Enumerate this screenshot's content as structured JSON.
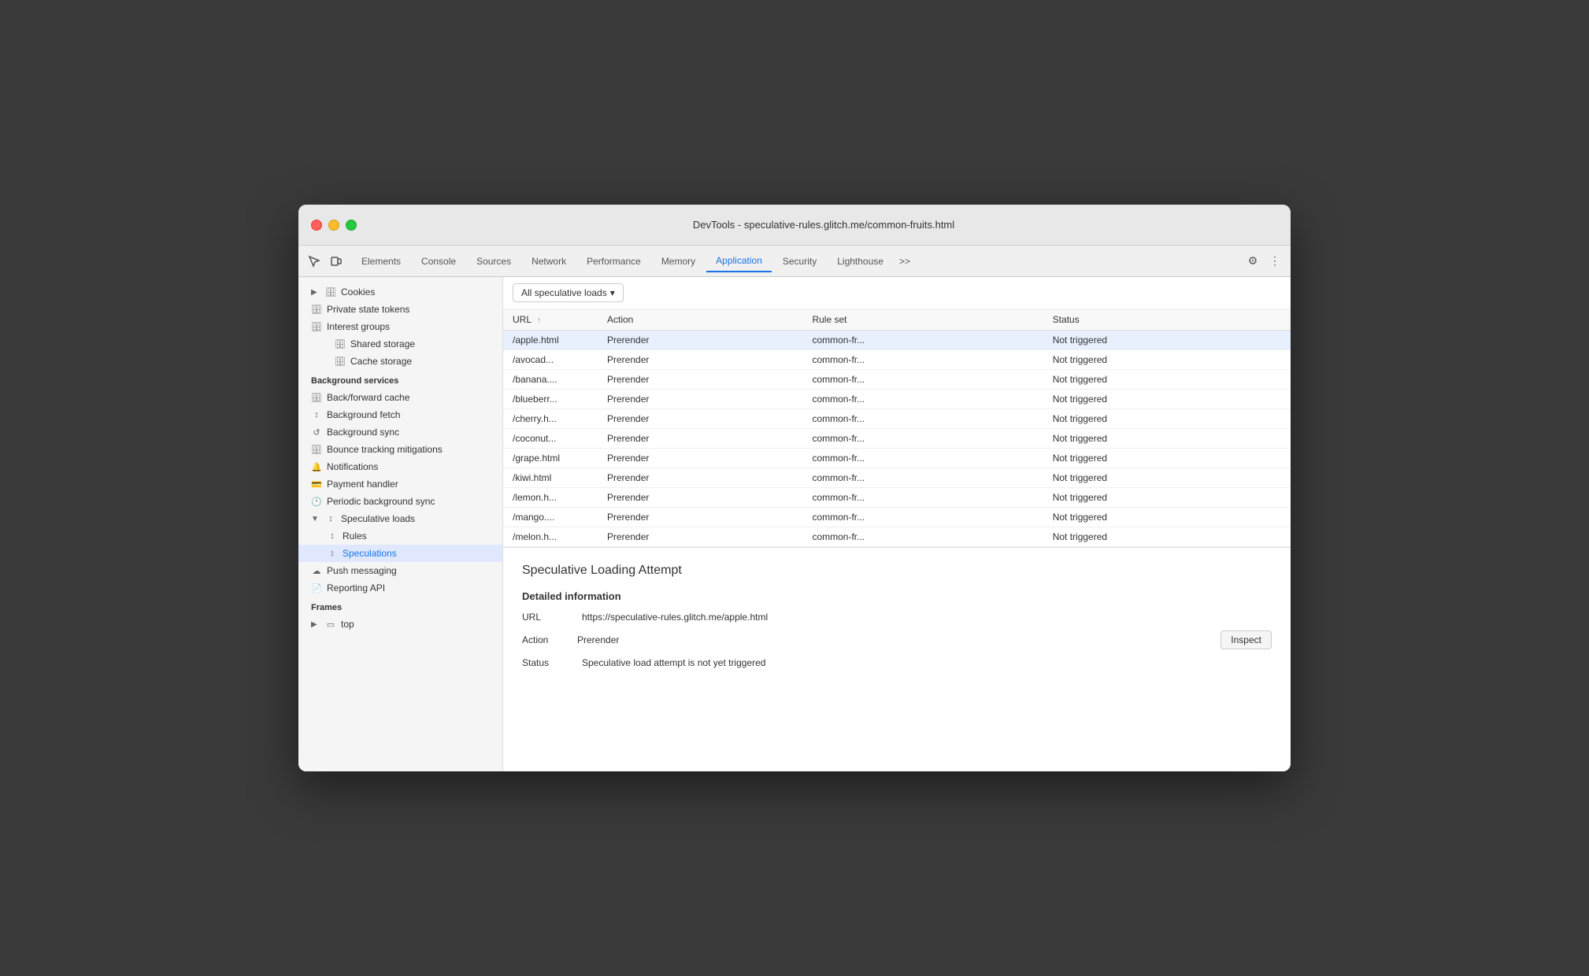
{
  "window": {
    "title": "DevTools - speculative-rules.glitch.me/common-fruits.html"
  },
  "tabs": {
    "items": [
      {
        "label": "Elements",
        "active": false
      },
      {
        "label": "Console",
        "active": false
      },
      {
        "label": "Sources",
        "active": false
      },
      {
        "label": "Network",
        "active": false
      },
      {
        "label": "Performance",
        "active": false
      },
      {
        "label": "Memory",
        "active": false
      },
      {
        "label": "Application",
        "active": true
      },
      {
        "label": "Security",
        "active": false
      },
      {
        "label": "Lighthouse",
        "active": false
      }
    ],
    "more_label": ">>"
  },
  "sidebar": {
    "sections": [
      {
        "name": "storage-section",
        "items": [
          {
            "id": "cookies",
            "label": "Cookies",
            "icon": "db",
            "indent": 1,
            "arrow": true,
            "collapsed": true
          },
          {
            "id": "private-state-tokens",
            "label": "Private state tokens",
            "icon": "db",
            "indent": 0
          },
          {
            "id": "interest-groups",
            "label": "Interest groups",
            "icon": "db",
            "indent": 0
          },
          {
            "id": "shared-storage",
            "label": "Shared storage",
            "icon": "db",
            "indent": 1,
            "arrow": false,
            "collapsed": false
          },
          {
            "id": "cache-storage",
            "label": "Cache storage",
            "icon": "db",
            "indent": 1,
            "arrow": false,
            "collapsed": false
          }
        ]
      },
      {
        "name": "background-services",
        "label": "Background services",
        "items": [
          {
            "id": "back-forward-cache",
            "label": "Back/forward cache",
            "icon": "db",
            "indent": 0
          },
          {
            "id": "background-fetch",
            "label": "Background fetch",
            "icon": "sync",
            "indent": 0
          },
          {
            "id": "background-sync",
            "label": "Background sync",
            "icon": "sync",
            "indent": 0
          },
          {
            "id": "bounce-tracking",
            "label": "Bounce tracking mitigations",
            "icon": "db",
            "indent": 0
          },
          {
            "id": "notifications",
            "label": "Notifications",
            "icon": "bell",
            "indent": 0
          },
          {
            "id": "payment-handler",
            "label": "Payment handler",
            "icon": "card",
            "indent": 0
          },
          {
            "id": "periodic-background-sync",
            "label": "Periodic background sync",
            "icon": "clock",
            "indent": 0
          },
          {
            "id": "speculative-loads",
            "label": "Speculative loads",
            "icon": "sync",
            "indent": 0,
            "arrow": true,
            "expanded": true
          },
          {
            "id": "rules",
            "label": "Rules",
            "icon": "sync",
            "indent": 1
          },
          {
            "id": "speculations",
            "label": "Speculations",
            "icon": "sync",
            "indent": 1,
            "active": true
          },
          {
            "id": "push-messaging",
            "label": "Push messaging",
            "icon": "cloud",
            "indent": 0
          },
          {
            "id": "reporting-api",
            "label": "Reporting API",
            "icon": "file",
            "indent": 0
          }
        ]
      },
      {
        "name": "frames-section",
        "label": "Frames",
        "items": [
          {
            "id": "top-frame",
            "label": "top",
            "icon": "frame",
            "indent": 1,
            "arrow": true,
            "collapsed": true
          }
        ]
      }
    ]
  },
  "filter": {
    "label": "All speculative loads",
    "dropdown_arrow": "▾"
  },
  "table": {
    "columns": [
      {
        "id": "url",
        "label": "URL",
        "sortable": true
      },
      {
        "id": "action",
        "label": "Action"
      },
      {
        "id": "ruleset",
        "label": "Rule set"
      },
      {
        "id": "status",
        "label": "Status"
      }
    ],
    "rows": [
      {
        "url": "/apple.html",
        "action": "Prerender",
        "ruleset": "common-fr...",
        "status": "Not triggered",
        "selected": true
      },
      {
        "url": "/avocad...",
        "action": "Prerender",
        "ruleset": "common-fr...",
        "status": "Not triggered"
      },
      {
        "url": "/banana....",
        "action": "Prerender",
        "ruleset": "common-fr...",
        "status": "Not triggered"
      },
      {
        "url": "/blueberr...",
        "action": "Prerender",
        "ruleset": "common-fr...",
        "status": "Not triggered"
      },
      {
        "url": "/cherry.h...",
        "action": "Prerender",
        "ruleset": "common-fr...",
        "status": "Not triggered"
      },
      {
        "url": "/coconut...",
        "action": "Prerender",
        "ruleset": "common-fr...",
        "status": "Not triggered"
      },
      {
        "url": "/grape.html",
        "action": "Prerender",
        "ruleset": "common-fr...",
        "status": "Not triggered"
      },
      {
        "url": "/kiwi.html",
        "action": "Prerender",
        "ruleset": "common-fr...",
        "status": "Not triggered"
      },
      {
        "url": "/lemon.h...",
        "action": "Prerender",
        "ruleset": "common-fr...",
        "status": "Not triggered"
      },
      {
        "url": "/mango....",
        "action": "Prerender",
        "ruleset": "common-fr...",
        "status": "Not triggered"
      },
      {
        "url": "/melon.h...",
        "action": "Prerender",
        "ruleset": "common-fr...",
        "status": "Not triggered"
      }
    ]
  },
  "detail": {
    "title": "Speculative Loading Attempt",
    "section_title": "Detailed information",
    "url_label": "URL",
    "url_value": "https://speculative-rules.glitch.me/apple.html",
    "action_label": "Action",
    "action_value": "Prerender",
    "inspect_button": "Inspect",
    "status_label": "Status",
    "status_value": "Speculative load attempt is not yet triggered"
  },
  "colors": {
    "active_tab": "#1a73e8",
    "selected_row": "#e8f0fe",
    "active_sidebar": "#e0e8ff"
  }
}
